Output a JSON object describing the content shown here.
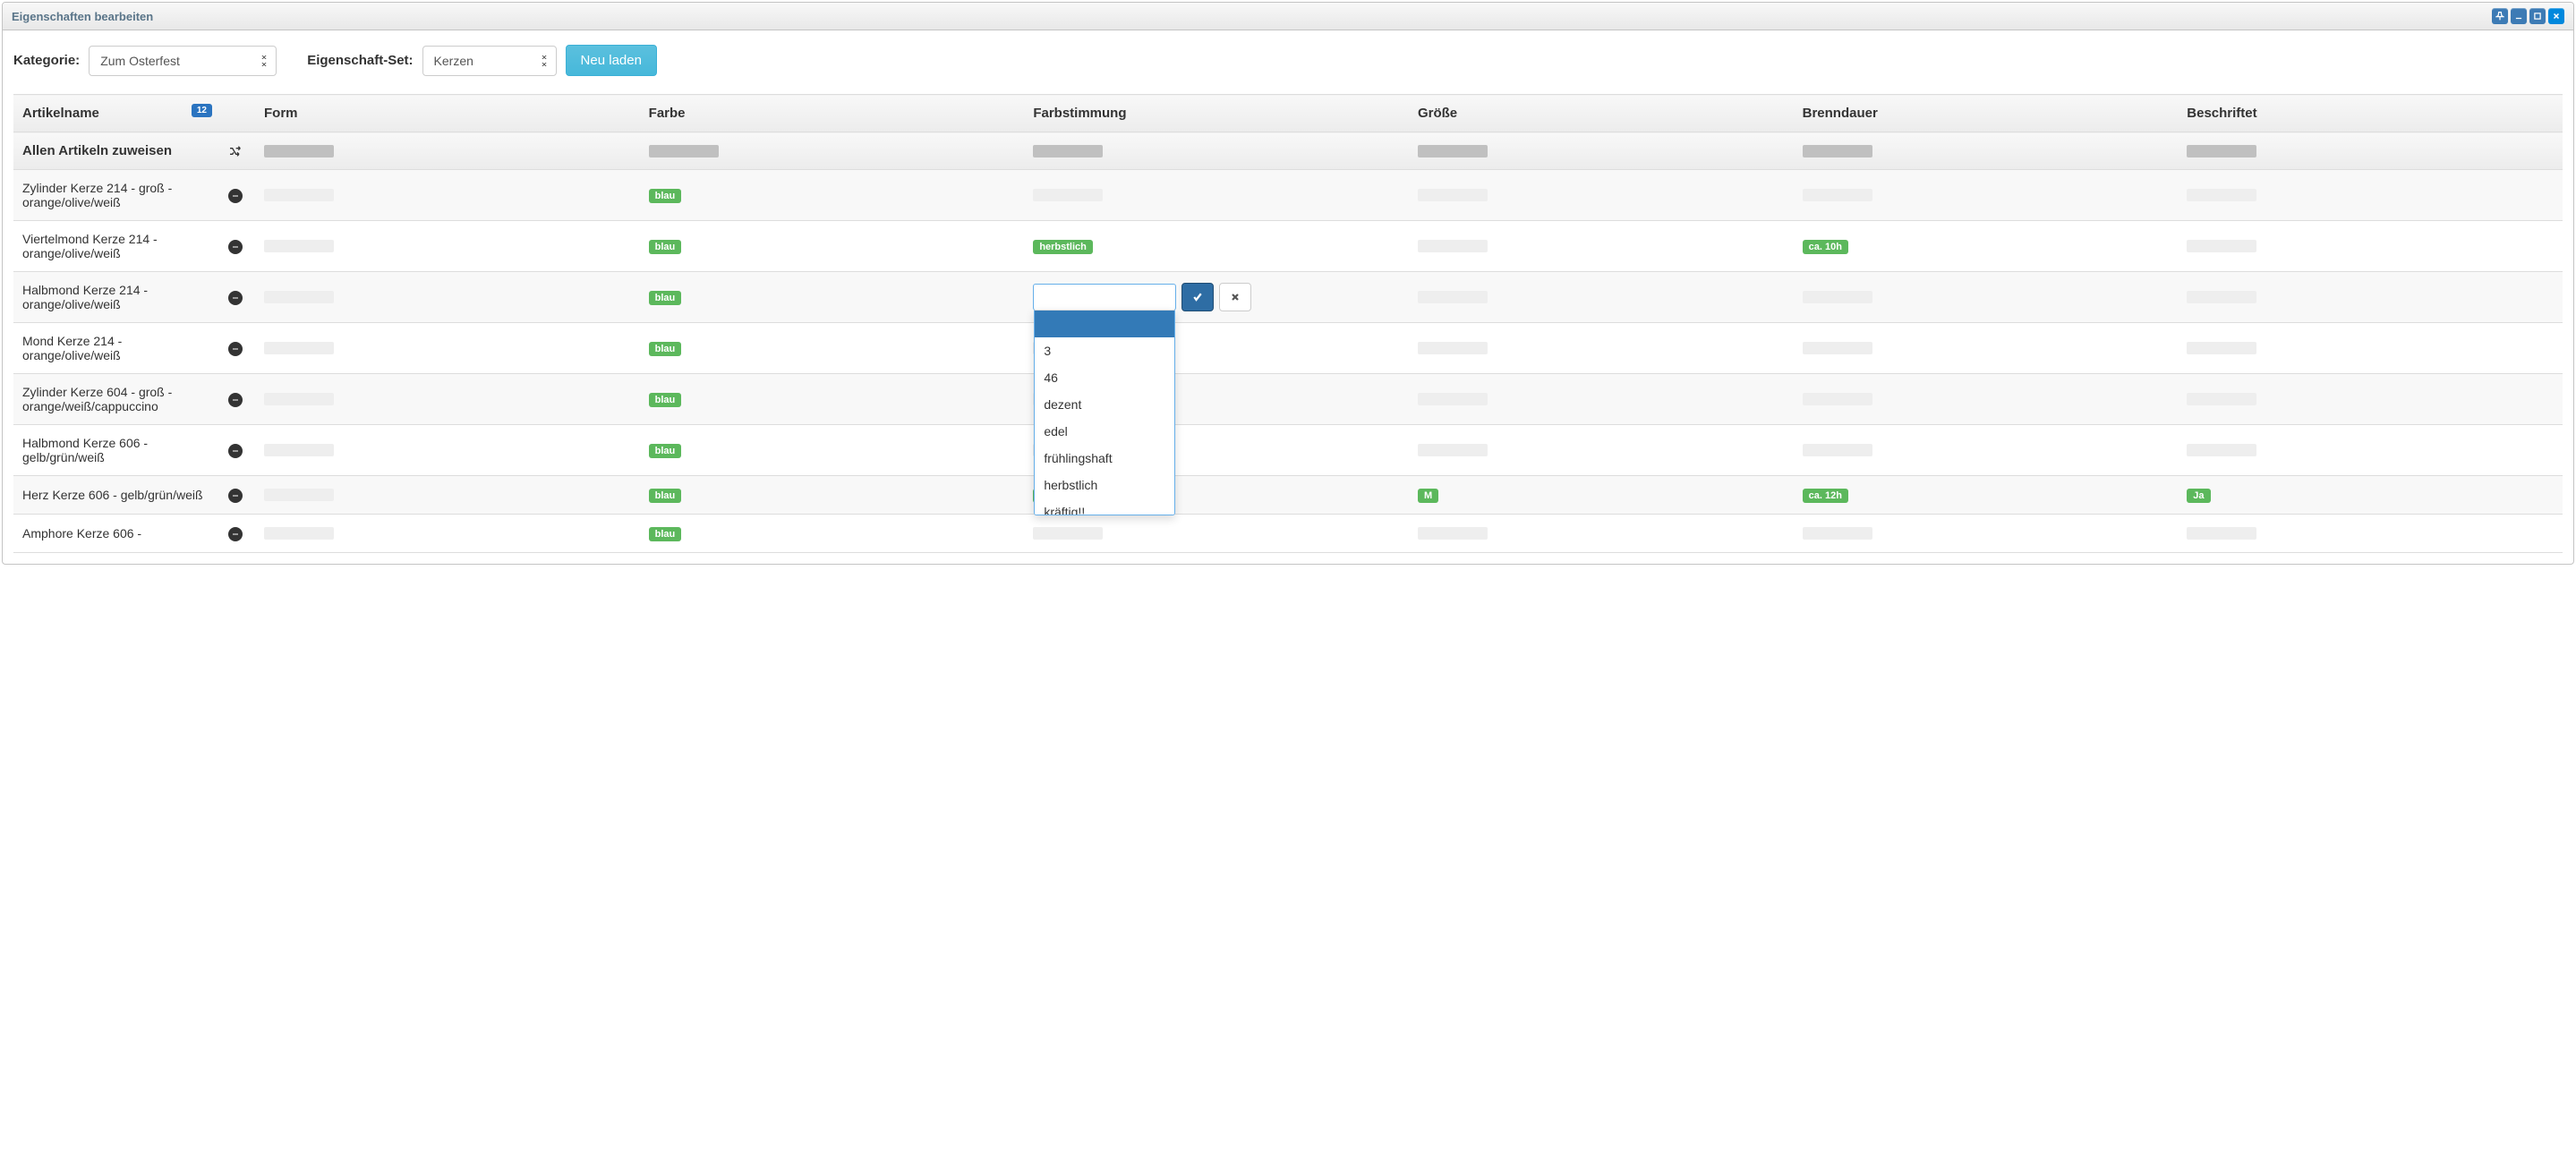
{
  "window": {
    "title": "Eigenschaften bearbeiten"
  },
  "filters": {
    "category_label": "Kategorie:",
    "category_value": "Zum Osterfest",
    "prop_set_label": "Eigenschaft-Set:",
    "prop_set_value": "Kerzen",
    "reload_label": "Neu laden"
  },
  "columns": {
    "name": "Artikelname",
    "form": "Form",
    "farbe": "Farbe",
    "farbstimmung": "Farbstimmung",
    "groesse": "Größe",
    "brenndauer": "Brenndauer",
    "beschriftet": "Beschriftet"
  },
  "count_badge": "12",
  "assign_all_label": "Allen Artikeln zuweisen",
  "rows": [
    {
      "name": "Zylinder Kerze 214 - groß - orange/olive/weiß",
      "farbe": "blau",
      "farbstimmung": null,
      "groesse": null,
      "brenndauer": null,
      "beschriftet": null,
      "editing": false
    },
    {
      "name": "Viertelmond Kerze 214 - orange/olive/weiß",
      "farbe": "blau",
      "farbstimmung": "herbstlich",
      "groesse": null,
      "brenndauer": "ca. 10h",
      "beschriftet": null,
      "editing": false
    },
    {
      "name": "Halbmond Kerze 214 - orange/olive/weiß",
      "farbe": "blau",
      "farbstimmung": null,
      "groesse": null,
      "brenndauer": null,
      "beschriftet": null,
      "editing": true
    },
    {
      "name": "Mond Kerze 214 - orange/olive/weiß",
      "farbe": "blau",
      "farbstimmung": null,
      "groesse": null,
      "brenndauer": null,
      "beschriftet": null,
      "editing": false
    },
    {
      "name": "Zylinder Kerze 604 - groß - orange/weiß/cappuccino",
      "farbe": "blau",
      "farbstimmung": null,
      "groesse": null,
      "brenndauer": null,
      "beschriftet": null,
      "editing": false
    },
    {
      "name": "Halbmond Kerze 606 - gelb/grün/weiß",
      "farbe": "blau",
      "farbstimmung": null,
      "groesse": null,
      "brenndauer": null,
      "beschriftet": null,
      "editing": false
    },
    {
      "name": "Herz Kerze 606 - gelb/grün/weiß",
      "farbe": "blau",
      "farbstimmung": "frühlingshaft",
      "groesse": "M",
      "brenndauer": "ca. 12h",
      "beschriftet": "Ja",
      "editing": false
    },
    {
      "name": "Amphore Kerze 606 -",
      "farbe": "blau",
      "farbstimmung": null,
      "groesse": null,
      "brenndauer": null,
      "beschriftet": null,
      "editing": false
    }
  ],
  "combo_options": [
    "",
    "3",
    "46",
    "dezent",
    "edel",
    "frühlingshaft",
    "herbstlich",
    "kräftig!!"
  ]
}
